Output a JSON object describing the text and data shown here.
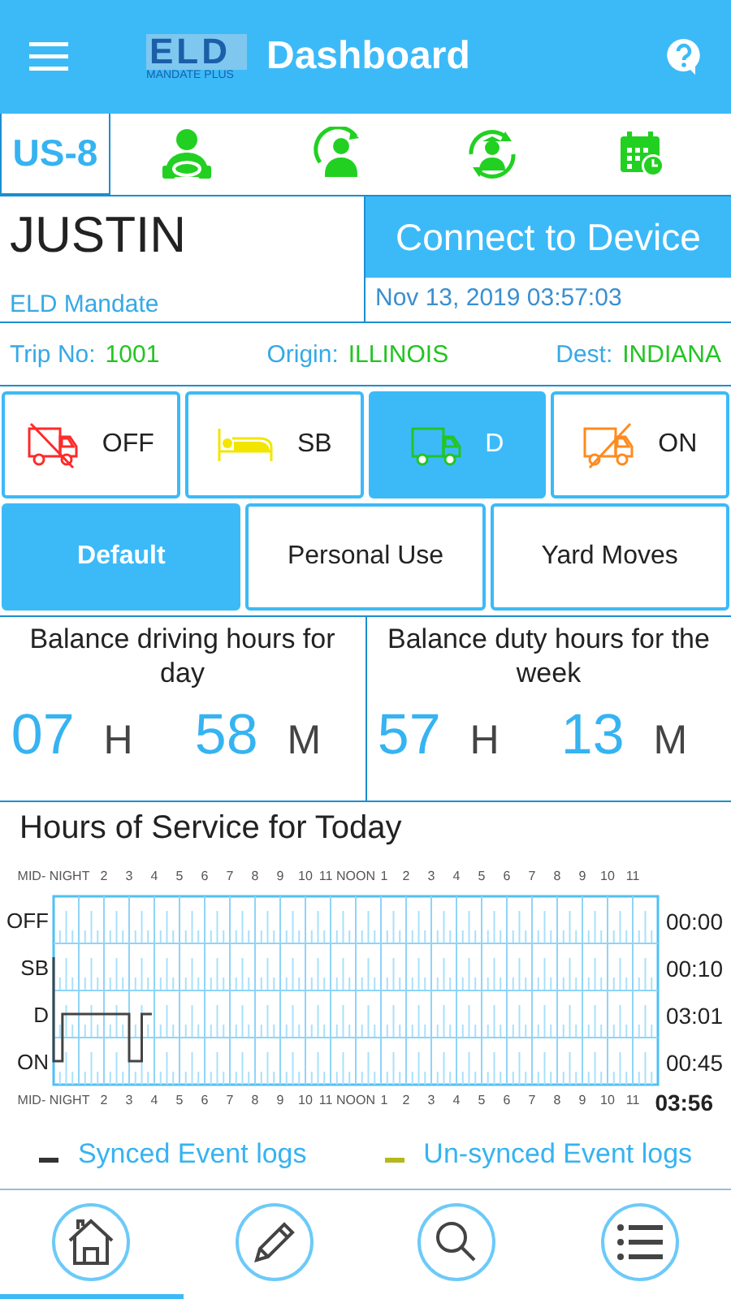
{
  "header": {
    "logo_word": "ELD",
    "logo_sub": "MANDATE PLUS",
    "title": "Dashboard"
  },
  "toolbar": {
    "rule": "US-8"
  },
  "driver": {
    "name": "JUSTIN",
    "company": "ELD Mandate",
    "connect": "Connect to Device",
    "datetime": "Nov 13, 2019 03:57:03"
  },
  "trip": [
    {
      "label": "Trip No:",
      "value": "1001"
    },
    {
      "label": "Origin:",
      "value": "ILLINOIS"
    },
    {
      "label": "Dest:",
      "value": "INDIANA"
    }
  ],
  "statuses": [
    {
      "kind": "off",
      "label": "OFF",
      "selected": false
    },
    {
      "kind": "sb",
      "label": "SB",
      "selected": false
    },
    {
      "kind": "d",
      "label": "D",
      "selected": true
    },
    {
      "kind": "on",
      "label": "ON",
      "selected": false
    }
  ],
  "modes": [
    {
      "label": "Default",
      "selected": true
    },
    {
      "label": "Personal Use",
      "selected": false
    },
    {
      "label": "Yard Moves",
      "selected": false
    }
  ],
  "balances": [
    {
      "title": "Balance driving hours for day",
      "hours": "07",
      "h_unit": "H",
      "minutes": "58",
      "m_unit": "M"
    },
    {
      "title": "Balance duty hours for the week",
      "hours": "57",
      "h_unit": "H",
      "minutes": "13",
      "m_unit": "M"
    }
  ],
  "hos": {
    "title": "Hours of Service for Today",
    "top_hour_labels": [
      "MID- NIGHT",
      "2",
      "3",
      "4",
      "5",
      "6",
      "7",
      "8",
      "9",
      "10",
      "11",
      "NOON",
      "1",
      "2",
      "3",
      "4",
      "5",
      "6",
      "7",
      "8",
      "9",
      "10",
      "11"
    ],
    "bottom_hour_labels": [
      "MID- NIGHT",
      "2",
      "3",
      "4",
      "5",
      "6",
      "7",
      "8",
      "9",
      "10",
      "11",
      "NOON",
      "1",
      "2",
      "3",
      "4",
      "5",
      "6",
      "7",
      "8",
      "9",
      "10",
      "11"
    ],
    "rows": [
      {
        "label": "OFF",
        "total": "00:00"
      },
      {
        "label": "SB",
        "total": "00:10"
      },
      {
        "label": "D",
        "total": "03:01"
      },
      {
        "label": "ON",
        "total": "00:45"
      }
    ],
    "grand_total": "03:56"
  },
  "legend": [
    {
      "label": "Synced Event logs",
      "color": "#333333"
    },
    {
      "label": "Un-synced Event logs",
      "color": "#b5b81c"
    }
  ],
  "nav": [
    {
      "kind": "home",
      "selected": true
    },
    {
      "kind": "edit",
      "selected": false
    },
    {
      "kind": "search",
      "selected": false
    },
    {
      "kind": "list",
      "selected": false
    }
  ]
}
